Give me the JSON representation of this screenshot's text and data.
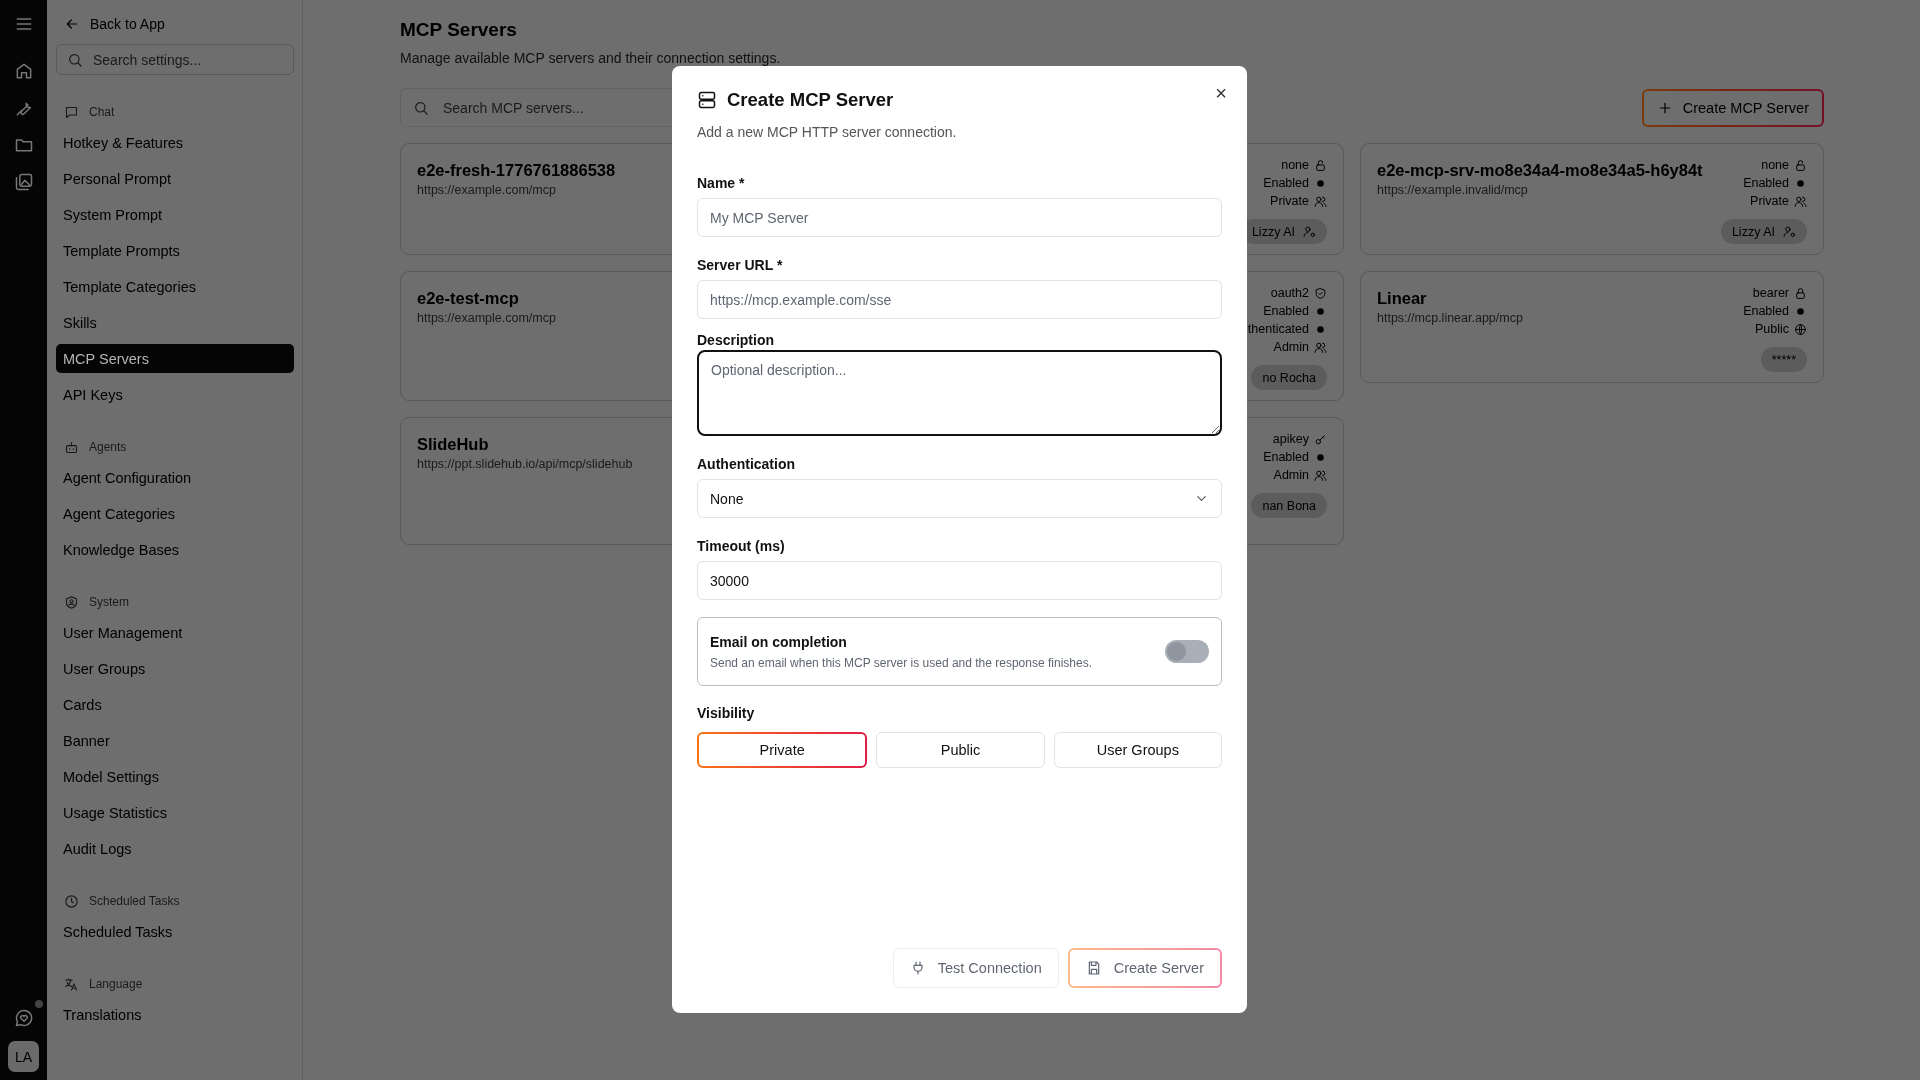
{
  "rail": {
    "notification_dot": true,
    "avatar": "LA"
  },
  "settings_nav": {
    "back": "Back to App",
    "search_placeholder": "Search settings...",
    "sections": [
      {
        "title": "Chat",
        "items": [
          {
            "label": "Hotkey & Features",
            "selected": false
          },
          {
            "label": "Personal Prompt",
            "selected": false
          },
          {
            "label": "System Prompt",
            "selected": false
          },
          {
            "label": "Template Prompts",
            "selected": false
          },
          {
            "label": "Template Categories",
            "selected": false
          },
          {
            "label": "Skills",
            "selected": false
          },
          {
            "label": "MCP Servers",
            "selected": true
          },
          {
            "label": "API Keys",
            "selected": false
          }
        ]
      },
      {
        "title": "Agents",
        "items": [
          {
            "label": "Agent Configuration",
            "selected": false
          },
          {
            "label": "Agent Categories",
            "selected": false
          },
          {
            "label": "Knowledge Bases",
            "selected": false
          }
        ]
      },
      {
        "title": "System",
        "items": [
          {
            "label": "User Management",
            "selected": false
          },
          {
            "label": "User Groups",
            "selected": false
          },
          {
            "label": "Cards",
            "selected": false
          },
          {
            "label": "Banner",
            "selected": false
          },
          {
            "label": "Model Settings",
            "selected": false
          },
          {
            "label": "Usage Statistics",
            "selected": false
          },
          {
            "label": "Audit Logs",
            "selected": false
          }
        ]
      },
      {
        "title": "Scheduled Tasks",
        "items": [
          {
            "label": "Scheduled Tasks",
            "selected": false
          }
        ]
      },
      {
        "title": "Language",
        "items": [
          {
            "label": "Translations",
            "selected": false
          }
        ]
      }
    ]
  },
  "page": {
    "title": "MCP Servers",
    "subtitle": "Manage available MCP servers and their connection settings.",
    "search_placeholder": "Search MCP servers...",
    "create_button": "Create MCP Server"
  },
  "servers": [
    {
      "name": "e2e-fresh-1776761886538",
      "url": "https://example.com/mcp",
      "meta": [
        {
          "text": "none",
          "kind": "unsecured"
        },
        {
          "text": "Enabled",
          "kind": "status"
        },
        {
          "text": "Private",
          "kind": "group"
        }
      ],
      "owner": {
        "text": "Lizzy AI",
        "kind": "user"
      }
    },
    {
      "name": "e2e-mcp-srv-mo8e34a4-mo8e34a5-h6y84t",
      "url": "https://example.invalid/mcp",
      "meta": [
        {
          "text": "none",
          "kind": "unsecured"
        },
        {
          "text": "Enabled",
          "kind": "status"
        },
        {
          "text": "Private",
          "kind": "group"
        }
      ],
      "owner": {
        "text": "Lizzy AI",
        "kind": "user"
      }
    },
    {
      "name": "e2e-test-mcp",
      "url": "https://example.com/mcp",
      "meta": [
        {
          "text": "oauth2",
          "kind": "oauth"
        },
        {
          "text": "Enabled",
          "kind": "status"
        },
        {
          "text": "thenticated",
          "kind": "status"
        },
        {
          "text": "Admin",
          "kind": "group"
        }
      ],
      "owner": {
        "text": "no Rocha",
        "kind": "plain"
      }
    },
    {
      "name": "Linear",
      "url": "https://mcp.linear.app/mcp",
      "meta": [
        {
          "text": "bearer",
          "kind": "bearer"
        },
        {
          "text": "Enabled",
          "kind": "status"
        },
        {
          "text": "Public",
          "kind": "public"
        }
      ],
      "owner": {
        "text": "*****",
        "kind": "plain"
      }
    },
    {
      "name": "SlideHub",
      "url": "https://ppt.slidehub.io/api/mcp/slidehub",
      "meta": [
        {
          "text": "apikey",
          "kind": "apikey"
        },
        {
          "text": "Enabled",
          "kind": "status"
        },
        {
          "text": "Admin",
          "kind": "group"
        }
      ],
      "owner": {
        "text": "nan Bona",
        "kind": "plain"
      }
    }
  ],
  "dialog": {
    "title": "Create MCP Server",
    "subtitle": "Add a new MCP HTTP server connection.",
    "close": "×",
    "fields": [
      {
        "kind": "text",
        "label": "Name *",
        "placeholder": "My MCP Server",
        "focused": false
      },
      {
        "kind": "text",
        "label": "Server URL *",
        "placeholder": "https://mcp.example.com/sse",
        "focused": false
      },
      {
        "kind": "textarea",
        "label": "Description",
        "placeholder": "Optional description...",
        "focused": true
      },
      {
        "kind": "select",
        "label": "Authentication",
        "value": "None",
        "focused": false
      },
      {
        "kind": "text",
        "label": "Timeout (ms)",
        "value": "30000",
        "focused": false
      }
    ],
    "email_toggle": {
      "title": "Email on completion",
      "description": "Send an email when this MCP server is used and the response finishes.",
      "on": false
    },
    "visibility": {
      "label": "Visibility",
      "options": [
        {
          "label": "Private",
          "selected": true
        },
        {
          "label": "Public",
          "selected": false
        },
        {
          "label": "User Groups",
          "selected": false
        }
      ]
    },
    "buttons": [
      {
        "kind": "test",
        "label": "Test Connection",
        "disabled": true
      },
      {
        "kind": "create",
        "label": "Create Server",
        "disabled": true
      }
    ]
  }
}
